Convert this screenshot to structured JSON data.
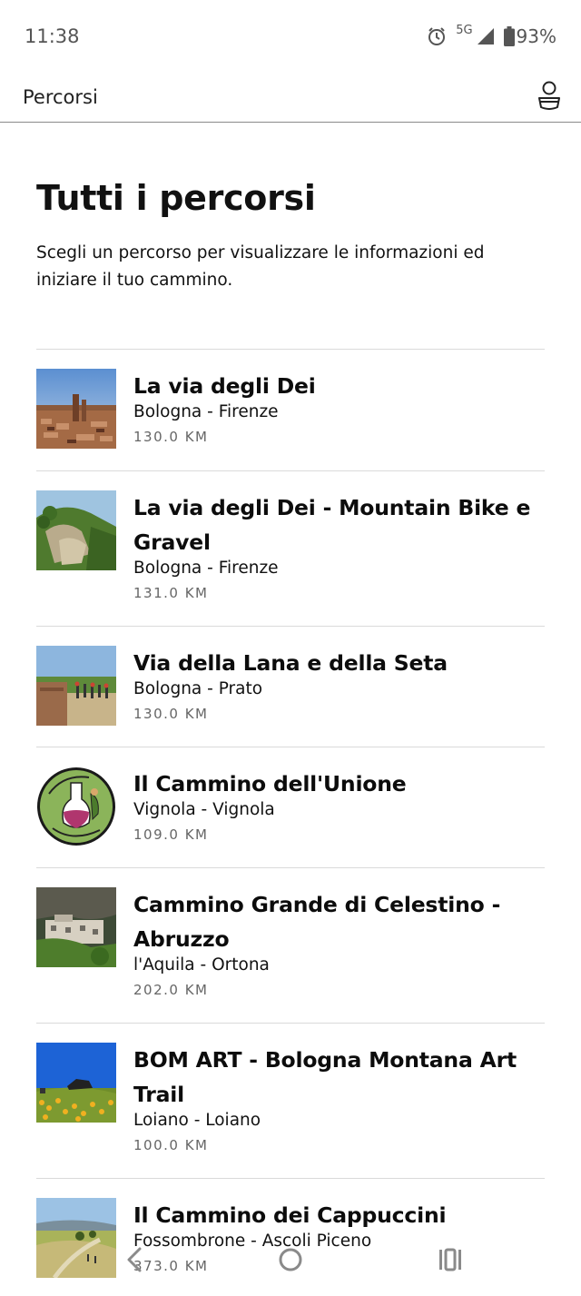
{
  "status": {
    "time": "11:38",
    "network": "5G",
    "battery": "93%"
  },
  "app_bar": {
    "title": "Percorsi",
    "profile_icon": "user-icon"
  },
  "main": {
    "heading": "Tutti i percorsi",
    "intro": "Scegli un percorso per visualizzare le informazioni ed iniziare il tuo cammino."
  },
  "routes": [
    {
      "name": "La via degli Dei",
      "endpoints": "Bologna - Firenze",
      "distance": "130.0 KM",
      "thumb": "bologna-towers-photo"
    },
    {
      "name": "La via degli Dei - Mountain Bike e Gravel",
      "endpoints": "Bologna - Firenze",
      "distance": "131.0 KM",
      "thumb": "rocky-hillside-photo"
    },
    {
      "name": "Via della Lana e della Seta",
      "endpoints": "Bologna - Prato",
      "distance": "130.0 KM",
      "thumb": "hikers-on-bridge-photo"
    },
    {
      "name": "Il Cammino dell'Unione",
      "endpoints": "Vignola - Vignola",
      "distance": "109.0 KM",
      "thumb": "cammino-unione-logo"
    },
    {
      "name": "Cammino Grande di Celestino - Abruzzo",
      "endpoints": "l'Aquila - Ortona",
      "distance": "202.0 KM",
      "thumb": "hermitage-cliff-photo"
    },
    {
      "name": "BOM ART - Bologna Montana Art Trail",
      "endpoints": "Loiano - Loiano",
      "distance": "100.0 KM",
      "thumb": "meadow-sculpture-photo"
    },
    {
      "name": "Il Cammino dei Cappuccini",
      "endpoints": "Fossombrone - Ascoli Piceno",
      "distance": "373.0 KM",
      "thumb": "countryside-path-photo"
    }
  ],
  "nav": {
    "back_icon": "back-chevron-icon",
    "home_icon": "home-circle-icon",
    "recents_icon": "recents-icon"
  }
}
